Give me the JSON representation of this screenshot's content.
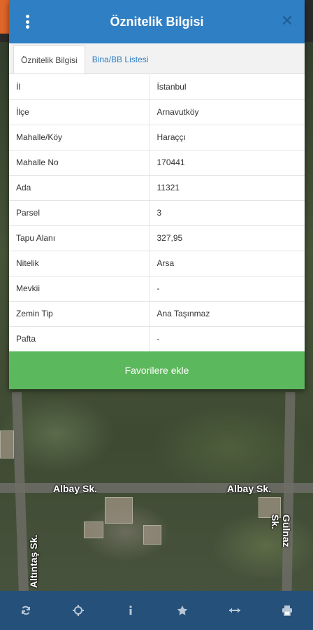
{
  "dialog": {
    "title": "Öznitelik Bilgisi",
    "close_label": "✕"
  },
  "tabs": [
    {
      "label": "Öznitelik Bilgisi",
      "active": true
    },
    {
      "label": "Bina/BB Listesi",
      "active": false
    }
  ],
  "attributes": [
    {
      "key": "İl",
      "value": "İstanbul"
    },
    {
      "key": "İlçe",
      "value": "Arnavutköy"
    },
    {
      "key": "Mahalle/Köy",
      "value": "Haraççı"
    },
    {
      "key": "Mahalle No",
      "value": "170441"
    },
    {
      "key": "Ada",
      "value": "11321"
    },
    {
      "key": "Parsel",
      "value": "3"
    },
    {
      "key": "Tapu Alanı",
      "value": "327,95"
    },
    {
      "key": "Nitelik",
      "value": "Arsa"
    },
    {
      "key": "Mevkii",
      "value": "-"
    },
    {
      "key": "Zemin Tip",
      "value": "Ana Taşınmaz"
    },
    {
      "key": "Pafta",
      "value": "-"
    }
  ],
  "favorite_button": "Favorilere ekle",
  "map_labels": {
    "albay_left": "Albay Sk.",
    "albay_right": "Albay Sk.",
    "altintas": "Altıntaş Sk.",
    "gulnaz": "Gülnaz Sk."
  },
  "toolbar": {
    "icons": [
      "refresh-icon",
      "locate-icon",
      "info-icon",
      "star-icon",
      "measure-icon",
      "print-icon"
    ]
  },
  "colors": {
    "header": "#2f7fc4",
    "favorite": "#5cb85c",
    "toolbar": "#24507a"
  }
}
